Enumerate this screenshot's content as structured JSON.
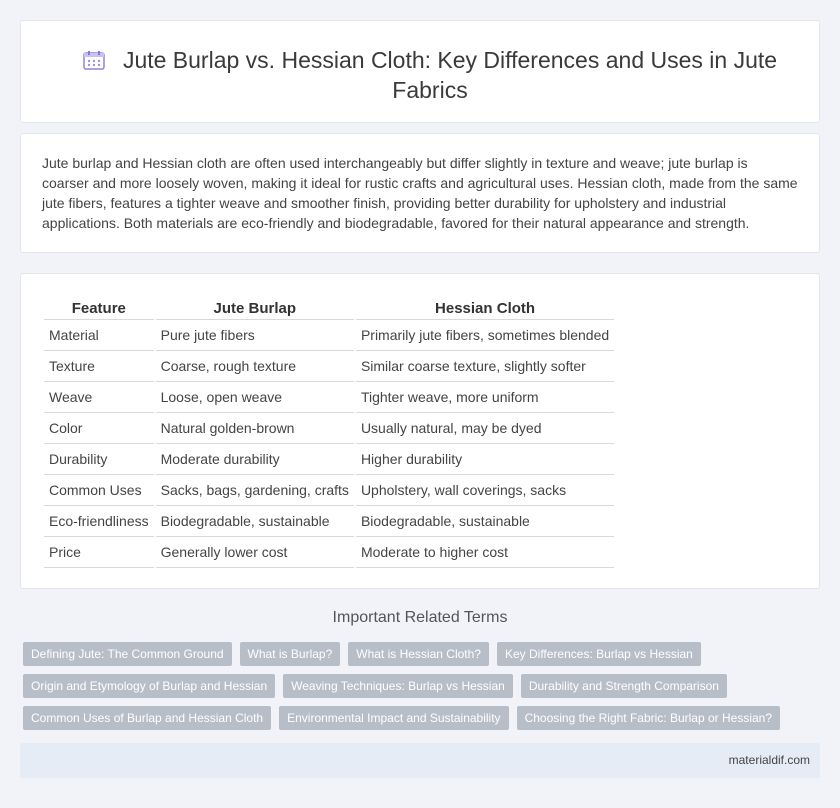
{
  "header": {
    "title": "Jute Burlap vs. Hessian Cloth: Key Differences and Uses in Jute Fabrics",
    "icon": "calendar-icon"
  },
  "intro": {
    "text": "Jute burlap and Hessian cloth are often used interchangeably but differ slightly in texture and weave; jute burlap is coarser and more loosely woven, making it ideal for rustic crafts and agricultural uses. Hessian cloth, made from the same jute fibers, features a tighter weave and smoother finish, providing better durability for upholstery and industrial applications. Both materials are eco-friendly and biodegradable, favored for their natural appearance and strength."
  },
  "table": {
    "headers": [
      "Feature",
      "Jute Burlap",
      "Hessian Cloth"
    ],
    "rows": [
      [
        "Material",
        "Pure jute fibers",
        "Primarily jute fibers, sometimes blended"
      ],
      [
        "Texture",
        "Coarse, rough texture",
        "Similar coarse texture, slightly softer"
      ],
      [
        "Weave",
        "Loose, open weave",
        "Tighter weave, more uniform"
      ],
      [
        "Color",
        "Natural golden-brown",
        "Usually natural, may be dyed"
      ],
      [
        "Durability",
        "Moderate durability",
        "Higher durability"
      ],
      [
        "Common Uses",
        "Sacks, bags, gardening, crafts",
        "Upholstery, wall coverings, sacks"
      ],
      [
        "Eco-friendliness",
        "Biodegradable, sustainable",
        "Biodegradable, sustainable"
      ],
      [
        "Price",
        "Generally lower cost",
        "Moderate to higher cost"
      ]
    ]
  },
  "related": {
    "title": "Important Related Terms",
    "rows": [
      [
        "Defining Jute: The Common Ground",
        "What is Burlap?",
        "What is Hessian Cloth?",
        "Key Differences: Burlap vs Hessian"
      ],
      [
        "Origin and Etymology of Burlap and Hessian",
        "Weaving Techniques: Burlap vs Hessian",
        "Durability and Strength Comparison"
      ],
      [
        "Common Uses of Burlap and Hessian Cloth",
        "Environmental Impact and Sustainability",
        "Choosing the Right Fabric: Burlap or Hessian?"
      ]
    ]
  },
  "footer": {
    "site": "materialdif.com"
  },
  "colors": {
    "background": "#f1f3f8",
    "tag": "#b8bec8",
    "footer": "#e6ecf6",
    "icon_accent": "#7b6fd6"
  }
}
